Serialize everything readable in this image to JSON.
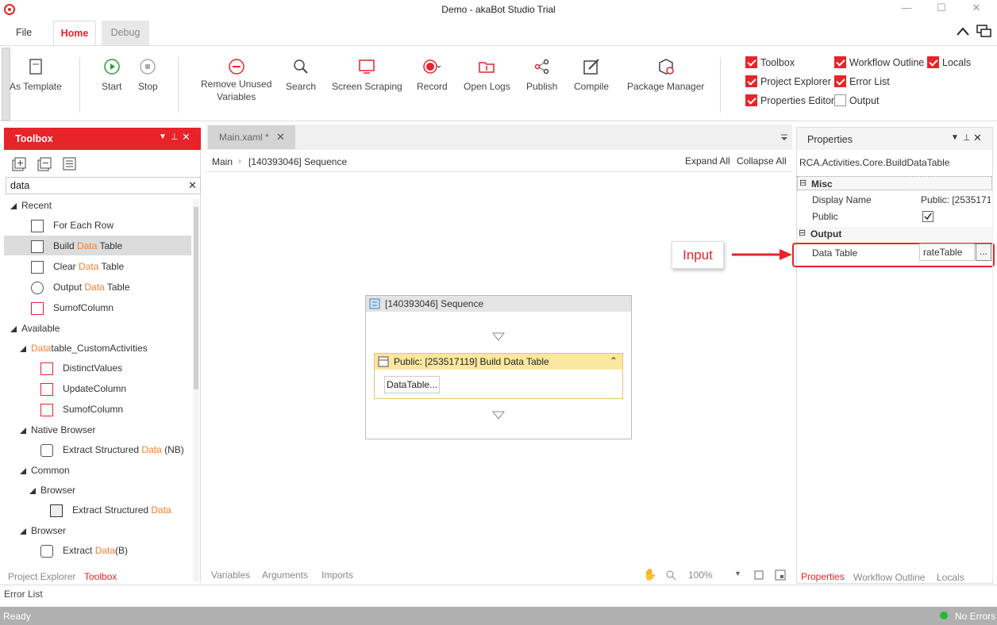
{
  "window": {
    "title": "Demo - akaBot Studio Trial"
  },
  "ribbon": {
    "tabs": [
      "File",
      "Home",
      "Debug"
    ],
    "buttons": {
      "as_template": "As Template",
      "start": "Start",
      "stop": "Stop",
      "remove_unused_1": "Remove Unused",
      "remove_unused_2": "Variables",
      "search": "Search",
      "screen_scraping": "Screen Scraping",
      "record": "Record",
      "open_logs": "Open Logs",
      "publish": "Publish",
      "compile": "Compile",
      "package_manager": "Package Manager"
    },
    "checkboxes": [
      {
        "label": "Toolbox",
        "checked": true
      },
      {
        "label": "Workflow Outline",
        "checked": true
      },
      {
        "label": "Locals",
        "checked": true
      },
      {
        "label": "Project Explorer",
        "checked": true
      },
      {
        "label": "Error List",
        "checked": true
      },
      {
        "label": "Properties Editor",
        "checked": true
      },
      {
        "label": "Output",
        "checked": false
      }
    ]
  },
  "toolbox": {
    "title": "Toolbox",
    "search_value": "data",
    "recent": "Recent",
    "recent_items": [
      "For Each Row",
      "Build ",
      "Data",
      " Table",
      "Clear ",
      "Output ",
      "SumofColumn"
    ],
    "available": "Available",
    "dt_prefix": "Data",
    "dt_suffix": "table_CustomActivities",
    "dt_items": [
      "DistinctValues",
      "UpdateColumn",
      "SumofColumn"
    ],
    "native_browser": "Native Browser",
    "extract_structured": "Extract Structured ",
    "nb_suffix": " (NB)",
    "common": "Common",
    "browser": "Browser",
    "extract": "Extract ",
    "b_suffix": "(B)",
    "bottom_tabs": [
      "Project Explorer",
      "Toolbox"
    ]
  },
  "designer": {
    "doc_tab": "Main.xaml *",
    "breadcrumb": [
      "Main",
      "[140393046] Sequence"
    ],
    "expand_all": "Expand All",
    "collapse_all": "Collapse All",
    "sequence_title": "[140393046] Sequence",
    "activity_title": "Public: [253517119] Build Data Table",
    "activity_button": "DataTable...",
    "bottom_tabs": [
      "Variables",
      "Arguments",
      "Imports"
    ],
    "zoom": "100%"
  },
  "annotation": {
    "label": "Input",
    "color": "#e8232a"
  },
  "properties": {
    "title": "Properties",
    "type_name": "RCA.Activities.Core.BuildDataTable",
    "misc": "Misc",
    "display_name_label": "Display Name",
    "display_name_value": "Public: [2535171",
    "public_label": "Public",
    "public_checked": true,
    "output": "Output",
    "data_table_label": "Data Table",
    "data_table_value": "rateTable",
    "ellipsis": "...",
    "bottom_tabs": [
      "Properties",
      "Workflow Outline",
      "Locals"
    ]
  },
  "error_list": "Error List",
  "status": {
    "left": "Ready",
    "right": "No Errors",
    "dot_color": "#22bb33"
  },
  "colors": {
    "accent": "#e8232a",
    "highlight": "#f08030"
  }
}
